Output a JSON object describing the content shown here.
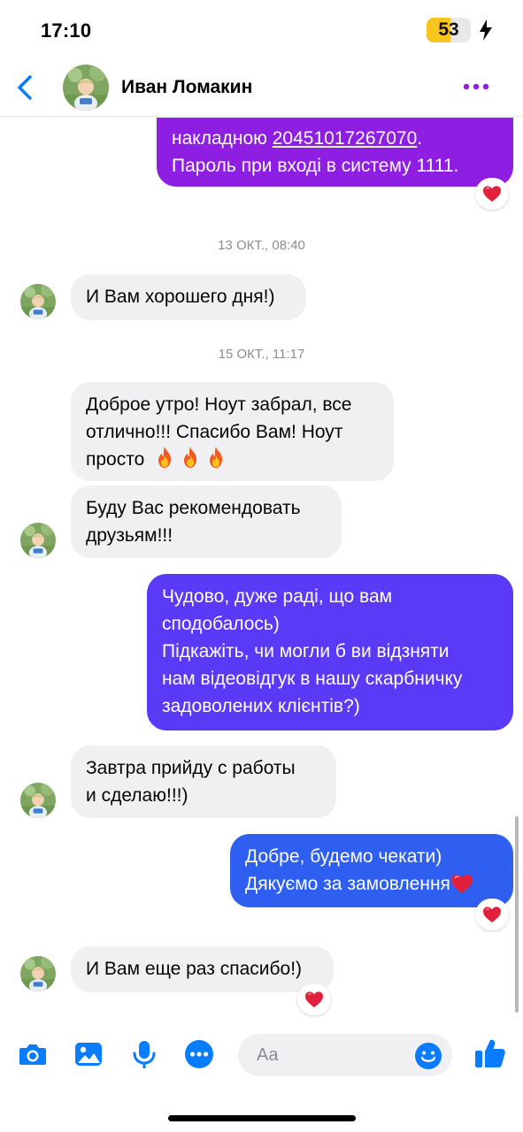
{
  "status_bar": {
    "time": "17:10",
    "battery_level": "53"
  },
  "header": {
    "contact_name": "Иван Ломакин"
  },
  "messages": [
    {
      "direction": "outgoing",
      "lines": [
        "накладною ",
        "20451017267070",
        ".",
        "Пароль при вході в систему 1111."
      ],
      "reaction": "heart"
    },
    {
      "type": "date",
      "text": "13 ОКТ., 08:40"
    },
    {
      "direction": "incoming",
      "text": "И Вам хорошего дня!)"
    },
    {
      "type": "date",
      "text": "15 ОКТ., 11:17"
    },
    {
      "direction": "incoming",
      "lines": [
        "Доброе утро! Ноут забрал, все",
        "отлично!!! Спасибо Вам! Ноут",
        "просто"
      ],
      "emoji": "fire x3"
    },
    {
      "direction": "incoming",
      "lines": [
        "Буду Вас рекомендовать",
        "друзьям!!!"
      ]
    },
    {
      "direction": "outgoing",
      "lines": [
        "Чудово, дуже раді, що вам",
        "сподобалось)",
        "Підкажіть, чи могли б ви відзняти",
        "нам відеовідгук в нашу скарбничку",
        "задоволених клієнтів?)"
      ]
    },
    {
      "direction": "incoming",
      "lines": [
        "Завтра прийду с работы",
        "и сделаю!!!)"
      ]
    },
    {
      "direction": "outgoing",
      "lines": [
        "Добре, будемо чекати)",
        "Дякуємо за замовлення"
      ],
      "emoji": "heart",
      "reaction": "heart"
    },
    {
      "direction": "incoming",
      "text": "И Вам еще раз спасибо!)",
      "reaction": "heart"
    }
  ],
  "composer": {
    "placeholder": "Aa",
    "icons": [
      "camera-icon",
      "gallery-icon",
      "microphone-icon",
      "more-apps-icon",
      "emoji-icon",
      "thumbs-up-icon"
    ]
  },
  "colors": {
    "accent": "#0a7cff",
    "purple_bubble": "#8f1ee3",
    "indigo_bubble": "#5a3af7",
    "blue_bubble": "#2e5ff0",
    "incoming_bubble": "#f0f0f2",
    "reaction_heart": "#e3203a"
  }
}
